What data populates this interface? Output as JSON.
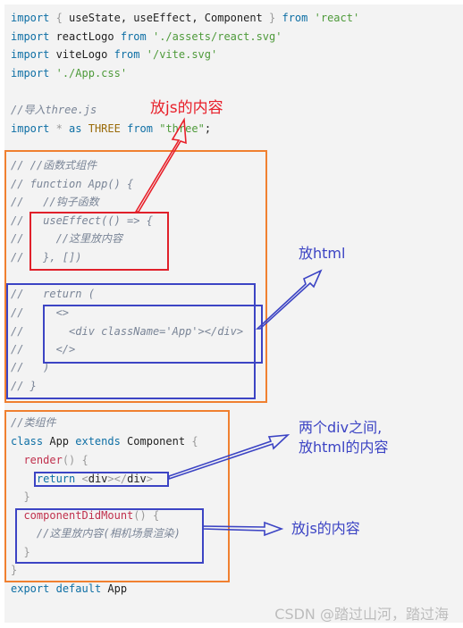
{
  "code": {
    "lines": [
      {
        "id": "l1",
        "parts": [
          {
            "t": "import",
            "c": "kw"
          },
          {
            "t": " { ",
            "c": "br"
          },
          {
            "t": "useState, useEffect, Component"
          },
          {
            "t": " } ",
            "c": "br"
          },
          {
            "t": "from",
            "c": "kw"
          },
          {
            "t": " "
          },
          {
            "t": "'react'",
            "c": "str"
          }
        ]
      },
      {
        "id": "l2",
        "parts": [
          {
            "t": "import",
            "c": "kw"
          },
          {
            "t": " reactLogo "
          },
          {
            "t": "from",
            "c": "kw"
          },
          {
            "t": " "
          },
          {
            "t": "'./assets/react.svg'",
            "c": "str"
          }
        ]
      },
      {
        "id": "l3",
        "parts": [
          {
            "t": "import",
            "c": "kw"
          },
          {
            "t": " viteLogo "
          },
          {
            "t": "from",
            "c": "kw"
          },
          {
            "t": " "
          },
          {
            "t": "'/vite.svg'",
            "c": "str"
          }
        ]
      },
      {
        "id": "l4",
        "parts": [
          {
            "t": "import",
            "c": "kw"
          },
          {
            "t": " "
          },
          {
            "t": "'./App.css'",
            "c": "str"
          }
        ]
      },
      {
        "id": "l5",
        "parts": []
      },
      {
        "id": "l6",
        "parts": [
          {
            "t": "//导入three.js",
            "c": "cm"
          }
        ]
      },
      {
        "id": "l7",
        "parts": [
          {
            "t": "import",
            "c": "kw"
          },
          {
            "t": " * ",
            "c": "br"
          },
          {
            "t": "as",
            "c": "kw"
          },
          {
            "t": " "
          },
          {
            "t": "THREE",
            "c": "cls"
          },
          {
            "t": " "
          },
          {
            "t": "from",
            "c": "kw"
          },
          {
            "t": " "
          },
          {
            "t": "\"three\"",
            "c": "str"
          },
          {
            "t": ";"
          }
        ]
      },
      {
        "id": "l8",
        "parts": []
      },
      {
        "id": "l9",
        "parts": [
          {
            "t": "// //函数式组件",
            "c": "cm"
          }
        ]
      },
      {
        "id": "l10",
        "parts": [
          {
            "t": "// function App() {",
            "c": "cm"
          }
        ]
      },
      {
        "id": "l11",
        "parts": [
          {
            "t": "//   //钩子函数",
            "c": "cm"
          }
        ]
      },
      {
        "id": "l12",
        "parts": [
          {
            "t": "//   useEffect(() => {",
            "c": "cm"
          }
        ]
      },
      {
        "id": "l13",
        "parts": [
          {
            "t": "//     //这里放内容",
            "c": "cm"
          }
        ]
      },
      {
        "id": "l14",
        "parts": [
          {
            "t": "//   }, [])",
            "c": "cm"
          }
        ]
      },
      {
        "id": "l15",
        "parts": []
      },
      {
        "id": "l16",
        "parts": [
          {
            "t": "//   return (",
            "c": "cm"
          }
        ]
      },
      {
        "id": "l17",
        "parts": [
          {
            "t": "//     <>",
            "c": "cm"
          }
        ]
      },
      {
        "id": "l18",
        "parts": [
          {
            "t": "//       <div className='App'></div>",
            "c": "cm"
          }
        ]
      },
      {
        "id": "l19",
        "parts": [
          {
            "t": "//     </>",
            "c": "cm"
          }
        ]
      },
      {
        "id": "l20",
        "parts": [
          {
            "t": "//   )",
            "c": "cm"
          }
        ]
      },
      {
        "id": "l21",
        "parts": [
          {
            "t": "// }",
            "c": "cm"
          }
        ]
      },
      {
        "id": "l22",
        "parts": []
      },
      {
        "id": "l23",
        "parts": [
          {
            "t": "//类组件",
            "c": "cm"
          }
        ]
      },
      {
        "id": "l24",
        "parts": [
          {
            "t": "class",
            "c": "kw"
          },
          {
            "t": " App "
          },
          {
            "t": "extends",
            "c": "kw"
          },
          {
            "t": " Component "
          },
          {
            "t": "{",
            "c": "br"
          }
        ]
      },
      {
        "id": "l25",
        "parts": [
          {
            "t": "  "
          },
          {
            "t": "render",
            "c": "fn"
          },
          {
            "t": "() {",
            "c": "br"
          }
        ]
      },
      {
        "id": "l26",
        "parts": [
          {
            "t": "    "
          },
          {
            "t": "return",
            "c": "kw"
          },
          {
            "t": " "
          },
          {
            "t": "<",
            "c": "br"
          },
          {
            "t": "div"
          },
          {
            "t": "></",
            "c": "br"
          },
          {
            "t": "div"
          },
          {
            "t": ">",
            "c": "br"
          }
        ]
      },
      {
        "id": "l27",
        "parts": [
          {
            "t": "  }",
            "c": "br"
          }
        ]
      },
      {
        "id": "l28",
        "parts": [
          {
            "t": "  "
          },
          {
            "t": "componentDidMount",
            "c": "fn"
          },
          {
            "t": "() {",
            "c": "br"
          }
        ]
      },
      {
        "id": "l29",
        "parts": [
          {
            "t": "    //这里放内容(相机场景渲染)",
            "c": "cm"
          }
        ]
      },
      {
        "id": "l30",
        "parts": [
          {
            "t": "  }",
            "c": "br"
          }
        ]
      },
      {
        "id": "l31",
        "parts": [
          {
            "t": "}",
            "c": "br"
          }
        ]
      },
      {
        "id": "l32",
        "parts": [
          {
            "t": "export",
            "c": "kw"
          },
          {
            "t": " "
          },
          {
            "t": "default",
            "c": "kw"
          },
          {
            "t": " App"
          }
        ]
      }
    ]
  },
  "annotations": {
    "js_content_top": "放js的内容",
    "html": "放html",
    "between_divs_line1": "两个div之间,",
    "between_divs_line2": "放html的内容",
    "js_content_bottom": "放js的内容"
  },
  "watermark": "CSDN @踏过山河，踏过海",
  "colors": {
    "background": "#f3f3f3",
    "orange_box": "#f08030",
    "red_box": "#e0202a",
    "blue_box": "#3c44c4"
  }
}
